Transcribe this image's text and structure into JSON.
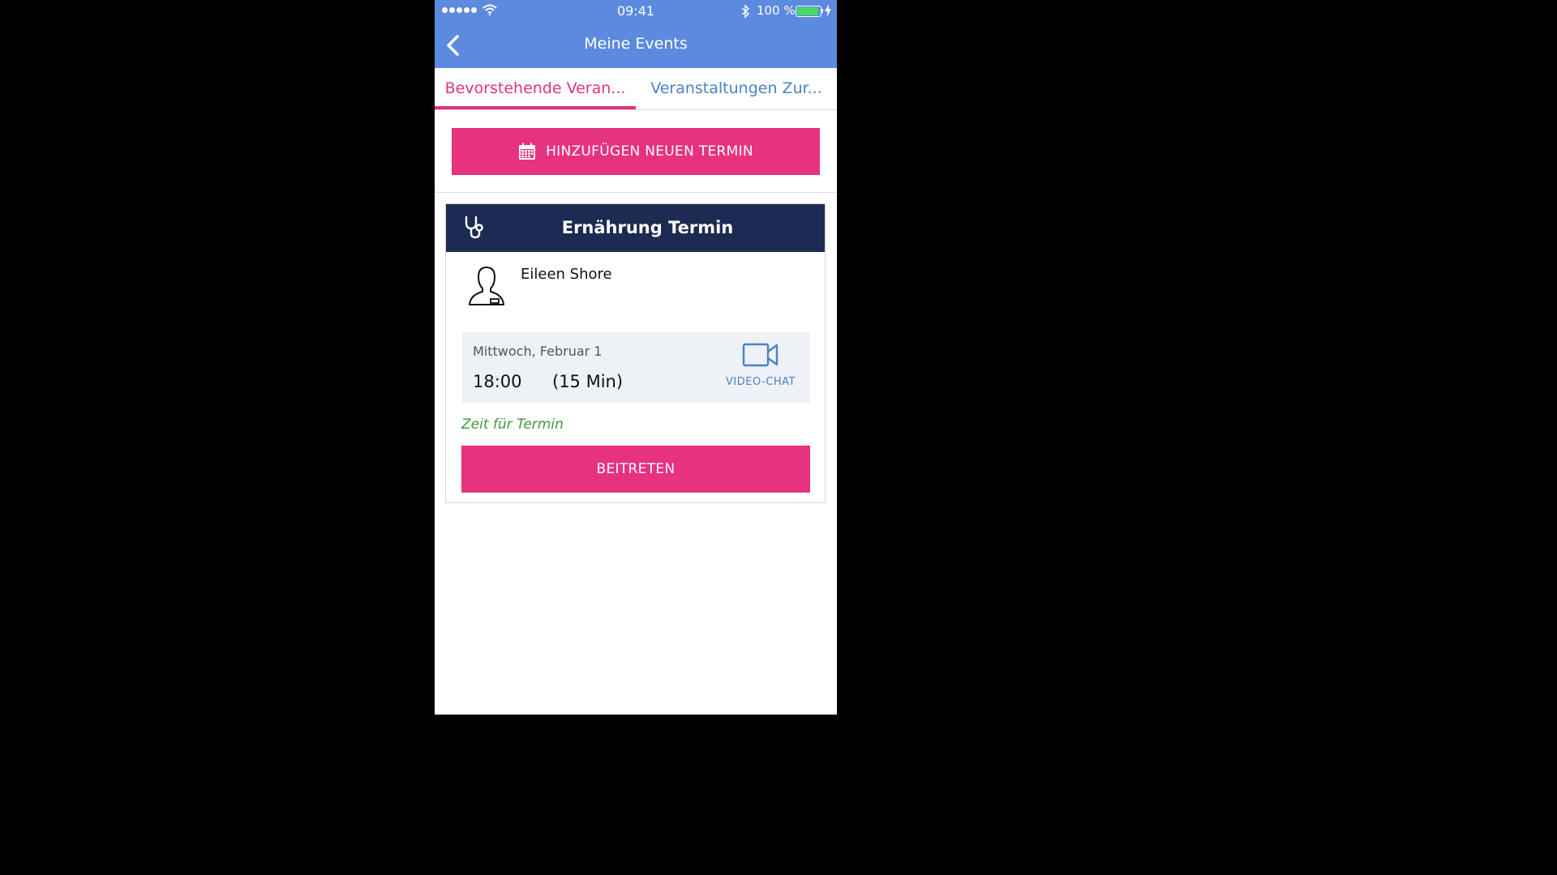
{
  "statusbar": {
    "time": "09:41",
    "battery_pct": "100 %",
    "battery_level": 1.0
  },
  "nav": {
    "title": "Meine Events"
  },
  "tabs": [
    {
      "label": "Bevorstehende Veran...",
      "active": true
    },
    {
      "label": "Veranstaltungen Zur...",
      "active": false
    }
  ],
  "add_button": {
    "label": "HINZUFÜGEN NEUEN TERMIN"
  },
  "event": {
    "title": "Ernährung Termin",
    "person": "Eileen Shore",
    "date": "Mittwoch, Februar 1",
    "time": "18:00",
    "duration": "(15 Min)",
    "video_label": "VIDEO-CHAT",
    "status": "Zeit für Termin",
    "join_label": "BEITRETEN"
  },
  "colors": {
    "header": "#5b8ade",
    "accent": "#e6327f",
    "card_header": "#1d2b53",
    "link": "#4a82c6",
    "status": "#3b9a3b"
  }
}
